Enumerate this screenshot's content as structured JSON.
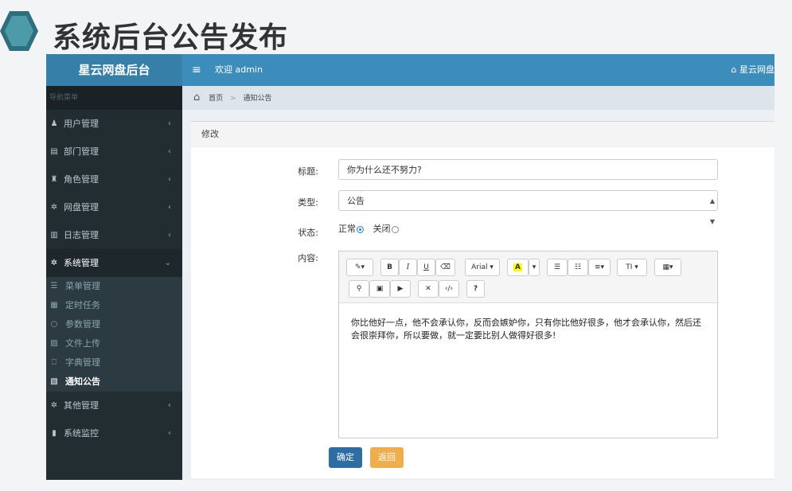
{
  "slide": {
    "title": "系统后台公告发布"
  },
  "app": {
    "brand": "星云网盘后台",
    "toggle_icon": "≡",
    "welcome": "欢迎 admin",
    "home_link": "星云网盘"
  },
  "sidebar": {
    "header": "导航菜单",
    "items": [
      {
        "icon": "user-icon",
        "glyph": "♟",
        "label": "用户管理",
        "chev": "‹"
      },
      {
        "icon": "id-card-icon",
        "glyph": "▤",
        "label": "部门管理",
        "chev": "‹"
      },
      {
        "icon": "role-icon",
        "glyph": "♜",
        "label": "角色管理",
        "chev": "‹"
      },
      {
        "icon": "gear-icon",
        "glyph": "✲",
        "label": "网盘管理",
        "chev": "‹"
      },
      {
        "icon": "log-icon",
        "glyph": "▥",
        "label": "日志管理",
        "chev": "‹"
      },
      {
        "icon": "gear-icon",
        "glyph": "✲",
        "label": "系统管理",
        "chev": "⌄"
      }
    ],
    "sub_items": [
      {
        "glyph": "☰",
        "label": "菜单管理"
      },
      {
        "glyph": "▦",
        "label": "定时任务"
      },
      {
        "glyph": "○",
        "label": "参数管理"
      },
      {
        "glyph": "▨",
        "label": "文件上传"
      },
      {
        "glyph": "⎕",
        "label": "字典管理"
      },
      {
        "glyph": "▧",
        "label": "通知公告"
      }
    ],
    "bottom_items": [
      {
        "glyph": "✲",
        "label": "其他管理",
        "chev": "‹"
      },
      {
        "glyph": "▮",
        "label": "系统监控",
        "chev": "‹"
      }
    ]
  },
  "breadcrumb": {
    "home": "首页",
    "sep": ">",
    "current": "通知公告"
  },
  "form": {
    "box_title": "修改",
    "title_label": "标题:",
    "title_value": "你为什么还不努力?",
    "type_label": "类型:",
    "type_value": "公告",
    "status_label": "状态:",
    "status_normal": "正常",
    "status_closed": "关闭",
    "content_label": "内容:",
    "content_text": "你比他好一点，他不会承认你，反而会嫉妒你，只有你比他好很多，他才会承认你，然后还会很崇拜你，所以要做，就一定要比别人做得好很多!",
    "confirm": "确定",
    "back": "返回"
  },
  "toolbar": {
    "magic": "✎▾",
    "bold": "B",
    "italic": "I",
    "underline": "U",
    "eraser": "⌫",
    "font": "Arial ▾",
    "color": "A",
    "color_drop": "▾",
    "ul": "☰",
    "ol": "☷",
    "align": "≡▾",
    "height": "TI ▾",
    "table": "▦▾",
    "link": "⚲",
    "picture": "▣",
    "video": "▶",
    "fullscreen": "✕",
    "code": "‹/›",
    "help": "?"
  },
  "colors": {
    "topbar": "#3c8dbc",
    "sidebar": "#222d32",
    "primary": "#2e6da4",
    "warning": "#f0ad4e"
  }
}
